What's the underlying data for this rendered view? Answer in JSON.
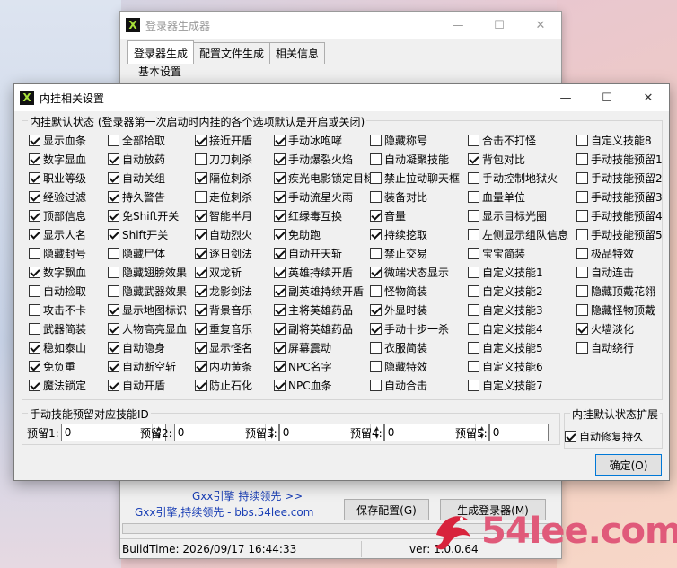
{
  "background_window": {
    "title": "登录器生成器",
    "tabs": [
      "登录器生成",
      "配置文件生成",
      "相关信息"
    ],
    "section_label": "基本设置",
    "link1": "Gxx引擎  持续领先  >>",
    "link2": "Gxx引擎,持续领先 - bbs.54lee.com",
    "save_button": "保存配置(G)",
    "generate_button": "生成登录器(M)",
    "build_time": "BuildTime:  2026/09/17 16:44:33",
    "version": "ver:  1.0.0.64"
  },
  "dialog": {
    "title": "内挂相关设置",
    "group_label": "内挂默认状态  (登录器第一次启动时内挂的各个选项默认是开启或关闭)",
    "columns": [
      [
        {
          "label": "显示血条",
          "checked": true
        },
        {
          "label": "数字显血",
          "checked": true
        },
        {
          "label": "职业等级",
          "checked": true
        },
        {
          "label": "经验过滤",
          "checked": true
        },
        {
          "label": "顶部信息",
          "checked": true
        },
        {
          "label": "显示人名",
          "checked": true
        },
        {
          "label": "隐藏封号",
          "checked": false
        },
        {
          "label": "数字飘血",
          "checked": true
        },
        {
          "label": "自动捡取",
          "checked": false
        },
        {
          "label": "攻击不卡",
          "checked": false
        },
        {
          "label": "武器简装",
          "checked": false
        },
        {
          "label": "稳如泰山",
          "checked": true
        },
        {
          "label": "免负重",
          "checked": true
        },
        {
          "label": "魔法锁定",
          "checked": true
        }
      ],
      [
        {
          "label": "全部拾取",
          "checked": false
        },
        {
          "label": "自动放药",
          "checked": true
        },
        {
          "label": "自动关组",
          "checked": true
        },
        {
          "label": "持久警告",
          "checked": true
        },
        {
          "label": "免Shift开关",
          "checked": true
        },
        {
          "label": "Shift开关",
          "checked": true
        },
        {
          "label": "隐藏尸体",
          "checked": false
        },
        {
          "label": "隐藏翅膀效果",
          "checked": false
        },
        {
          "label": "隐藏武器效果",
          "checked": false
        },
        {
          "label": "显示地图标识",
          "checked": true
        },
        {
          "label": "人物高亮显血",
          "checked": true
        },
        {
          "label": "自动隐身",
          "checked": true
        },
        {
          "label": "自动断空斩",
          "checked": true
        },
        {
          "label": "自动开盾",
          "checked": true
        }
      ],
      [
        {
          "label": "接近开盾",
          "checked": true
        },
        {
          "label": "刀刀刺杀",
          "checked": false
        },
        {
          "label": "隔位刺杀",
          "checked": true
        },
        {
          "label": "走位刺杀",
          "checked": false
        },
        {
          "label": "智能半月",
          "checked": true
        },
        {
          "label": "自动烈火",
          "checked": true
        },
        {
          "label": "逐日剑法",
          "checked": true
        },
        {
          "label": "双龙斩",
          "checked": true
        },
        {
          "label": "龙影剑法",
          "checked": true
        },
        {
          "label": "背景音乐",
          "checked": true
        },
        {
          "label": "重复音乐",
          "checked": true
        },
        {
          "label": "显示怪名",
          "checked": true
        },
        {
          "label": "内功黄条",
          "checked": true
        },
        {
          "label": "防止石化",
          "checked": true
        }
      ],
      [
        {
          "label": "手动冰咆哮",
          "checked": true
        },
        {
          "label": "手动爆裂火焰",
          "checked": true
        },
        {
          "label": "疾光电影锁定目标",
          "checked": true
        },
        {
          "label": "手动流星火雨",
          "checked": true
        },
        {
          "label": "红绿毒互换",
          "checked": true
        },
        {
          "label": "免助跑",
          "checked": true
        },
        {
          "label": "自动开天斩",
          "checked": true
        },
        {
          "label": "英雄持续开盾",
          "checked": true
        },
        {
          "label": "副英雄持续开盾",
          "checked": true
        },
        {
          "label": "主将英雄药品",
          "checked": true
        },
        {
          "label": "副将英雄药品",
          "checked": true
        },
        {
          "label": "屏幕震动",
          "checked": true
        },
        {
          "label": "NPC名字",
          "checked": true
        },
        {
          "label": "NPC血条",
          "checked": true
        }
      ],
      [
        {
          "label": "隐藏称号",
          "checked": false
        },
        {
          "label": "自动凝聚技能",
          "checked": false
        },
        {
          "label": "禁止拉动聊天框",
          "checked": false
        },
        {
          "label": "装备对比",
          "checked": false
        },
        {
          "label": "音量",
          "checked": true
        },
        {
          "label": "持续挖取",
          "checked": true
        },
        {
          "label": "禁止交易",
          "checked": false
        },
        {
          "label": "微端状态显示",
          "checked": true
        },
        {
          "label": "怪物简装",
          "checked": false
        },
        {
          "label": "外显时装",
          "checked": true
        },
        {
          "label": "手动十步一杀",
          "checked": true
        },
        {
          "label": "衣服简装",
          "checked": false
        },
        {
          "label": "隐藏特效",
          "checked": false
        },
        {
          "label": "自动合击",
          "checked": false
        }
      ],
      [
        {
          "label": "合击不打怪",
          "checked": false
        },
        {
          "label": "背包对比",
          "checked": true
        },
        {
          "label": "手动控制地狱火",
          "checked": false
        },
        {
          "label": "血量单位",
          "checked": false
        },
        {
          "label": "显示目标光圈",
          "checked": false
        },
        {
          "label": "左侧显示组队信息",
          "checked": false
        },
        {
          "label": "宝宝简装",
          "checked": false
        },
        {
          "label": "自定义技能1",
          "checked": false
        },
        {
          "label": "自定义技能2",
          "checked": false
        },
        {
          "label": "自定义技能3",
          "checked": false
        },
        {
          "label": "自定义技能4",
          "checked": false
        },
        {
          "label": "自定义技能5",
          "checked": false
        },
        {
          "label": "自定义技能6",
          "checked": false
        },
        {
          "label": "自定义技能7",
          "checked": false
        }
      ],
      [
        {
          "label": "自定义技能8",
          "checked": false
        },
        {
          "label": "手动技能预留1",
          "checked": false
        },
        {
          "label": "手动技能预留2",
          "checked": false
        },
        {
          "label": "手动技能预留3",
          "checked": false
        },
        {
          "label": "手动技能预留4",
          "checked": false
        },
        {
          "label": "手动技能预留5",
          "checked": false
        },
        {
          "label": "极品特效",
          "checked": false
        },
        {
          "label": "自动连击",
          "checked": false
        },
        {
          "label": "隐藏顶戴花翎",
          "checked": false
        },
        {
          "label": "隐藏怪物顶戴",
          "checked": false
        },
        {
          "label": "火墙淡化",
          "checked": true
        },
        {
          "label": "自动绕行",
          "checked": false
        }
      ]
    ],
    "reserve_group_label": "手动技能预留对应技能ID",
    "reserve_fields": [
      {
        "label": "预留1:",
        "value": "0"
      },
      {
        "label": "预留2:",
        "value": "0"
      },
      {
        "label": "预留3:",
        "value": "0"
      },
      {
        "label": "预留4:",
        "value": "0"
      },
      {
        "label": "预留5:",
        "value": "0"
      }
    ],
    "ext_group_label": "内挂默认状态扩展",
    "ext_checkbox": {
      "label": "自动修复持久",
      "checked": true
    },
    "ok_button": "确定(O)"
  },
  "watermark": "54lee.com"
}
